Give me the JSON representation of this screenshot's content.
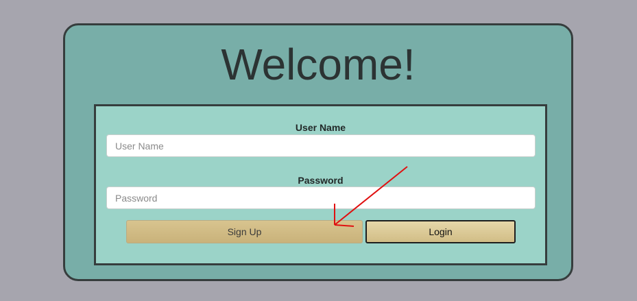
{
  "page": {
    "title": "Welcome!"
  },
  "form": {
    "username": {
      "label": "User Name",
      "placeholder": "User Name",
      "value": ""
    },
    "password": {
      "label": "Password",
      "placeholder": "Password",
      "value": ""
    },
    "signup_label": "Sign Up",
    "login_label": "Login"
  },
  "colors": {
    "background": "#a6a5ae",
    "card": "#78aea8",
    "form_panel": "#9bd3c8",
    "border": "#363d3d",
    "button": "#d1bd86",
    "annotation_arrow": "#e01010"
  },
  "icons": {
    "annotation": "red-arrow-icon"
  }
}
